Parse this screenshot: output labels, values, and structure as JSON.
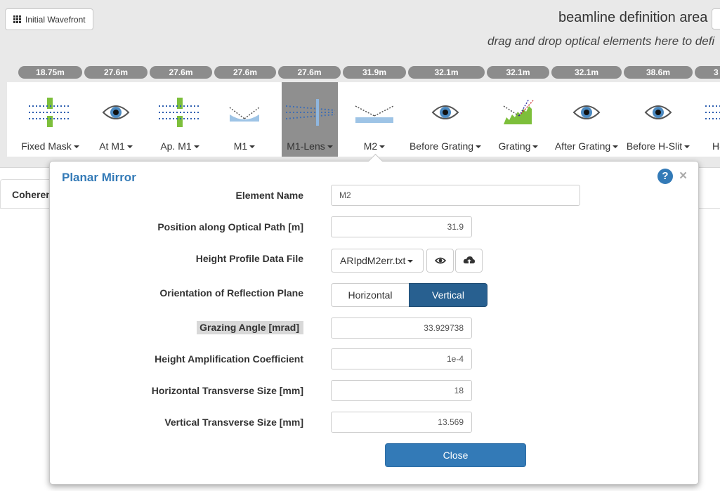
{
  "toolbar": {
    "initial_wavefront_label": "Initial Wavefront"
  },
  "beamline": {
    "title": "beamline definition area",
    "subtitle": "drag and drop optical elements here to defi",
    "positions": [
      "18.75m",
      "27.6m",
      "27.6m",
      "27.6m",
      "27.6m",
      "31.9m",
      "32.1m",
      "32.1m",
      "32.1m",
      "38.6m",
      "3"
    ],
    "elements": [
      {
        "label": "Fixed Mask",
        "icon": "aperture-icon"
      },
      {
        "label": "At M1",
        "icon": "eye-icon"
      },
      {
        "label": "Ap. M1",
        "icon": "aperture-icon"
      },
      {
        "label": "M1",
        "icon": "spherical-mirror-icon"
      },
      {
        "label": "M1-Lens",
        "icon": "lens-icon"
      },
      {
        "label": "M2",
        "icon": "planar-mirror-icon"
      },
      {
        "label": "Before Grating",
        "icon": "eye-icon"
      },
      {
        "label": "Grating",
        "icon": "grating-icon"
      },
      {
        "label": "After Grating",
        "icon": "eye-icon"
      },
      {
        "label": "Before H-Slit",
        "icon": "eye-icon"
      },
      {
        "label": "H-",
        "icon": "aperture-icon"
      }
    ],
    "selected_element": "M1-Lens"
  },
  "tabs": {
    "coherence_label": "Coheren"
  },
  "modal": {
    "title": "Planar Mirror",
    "fields": {
      "element_name": {
        "label": "Element Name",
        "value": "M2"
      },
      "position": {
        "label": "Position along Optical Path [m]",
        "value": "31.9"
      },
      "height_profile": {
        "label": "Height Profile Data File",
        "value": "ARIpdM2err.txt"
      },
      "orientation": {
        "label": "Orientation of Reflection Plane",
        "options": [
          "Horizontal",
          "Vertical"
        ],
        "selected": "Vertical"
      },
      "grazing_angle": {
        "label": "Grazing Angle [mrad]",
        "value": "33.929738"
      },
      "height_amplification": {
        "label": "Height Amplification Coefficient",
        "value": "1e-4"
      },
      "horizontal_size": {
        "label": "Horizontal Transverse Size [mm]",
        "value": "18"
      },
      "vertical_size": {
        "label": "Vertical Transverse Size [mm]",
        "value": "13.569"
      }
    },
    "close_label": "Close"
  },
  "colors": {
    "primary": "#337ab7",
    "active": "#286090",
    "pill": "#8c8c8c",
    "selected_element_bg": "#8f8f8f"
  }
}
